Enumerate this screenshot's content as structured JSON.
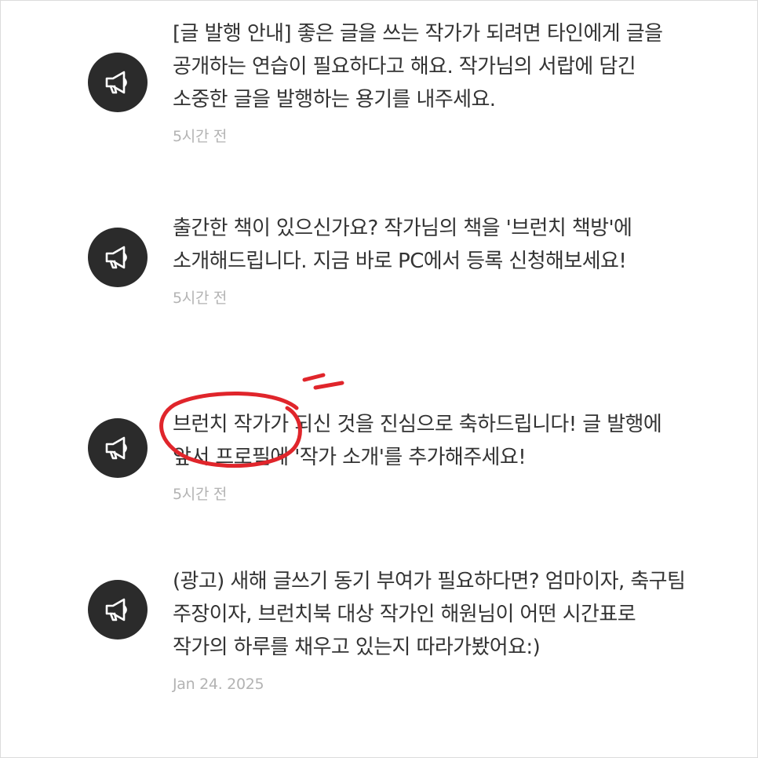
{
  "notifications": [
    {
      "icon": "megaphone-icon",
      "message": "[글 발행 안내] 좋은 글을 쓰는 작가가 되려면 타인에게 글을 공개하는 연습이 필요하다고 해요. 작가님의 서랍에 담긴 소중한 글을 발행하는 용기를 내주세요.",
      "time": "5시간 전"
    },
    {
      "icon": "megaphone-icon",
      "message": "출간한 책이 있으신가요? 작가님의 책을 '브런치 책방'에 소개해드립니다. 지금 바로 PC에서 등록 신청해보세요!",
      "time": "5시간 전"
    },
    {
      "icon": "megaphone-icon",
      "message": "브런치 작가가 되신 것을 진심으로 축하드립니다! 글 발행에 앞서 프로필에 '작가 소개'를 추가해주세요!",
      "time": "5시간 전"
    },
    {
      "icon": "megaphone-icon",
      "message": "(광고) 새해 글쓰기 동기 부여가 필요하다면? 엄마이자, 축구팀 주장이자, 브런치북 대상 작가인 해원님이 어떤 시간표로 작가의 하루를 채우고 있는지 따라가봤어요:)",
      "time": "Jan 24. 2025"
    }
  ],
  "colors": {
    "avatar_bg": "#2b2b2b",
    "message_text": "#333333",
    "time_text": "#b3b3b3",
    "annotation_red": "#e0252b"
  }
}
